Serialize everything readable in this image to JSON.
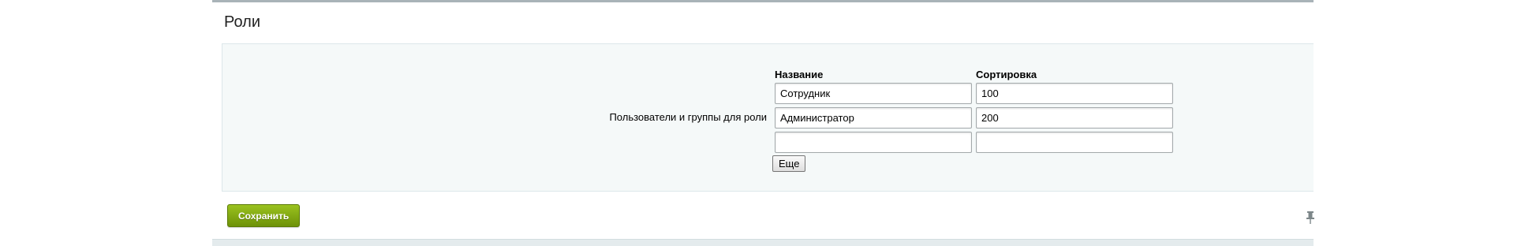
{
  "section": {
    "title": "Роли"
  },
  "field": {
    "label": "Пользователи и группы для роли"
  },
  "table": {
    "columns": {
      "name": "Название",
      "sort": "Сортировка"
    },
    "rows": [
      {
        "name": "Сотрудник",
        "sort": "100"
      },
      {
        "name": "Администратор",
        "sort": "200"
      },
      {
        "name": "",
        "sort": ""
      }
    ]
  },
  "buttons": {
    "more_label": "Еще",
    "save_label": "Сохранить"
  },
  "icons": {
    "pin": "pin-icon"
  },
  "colors": {
    "save_button": "#7ba30f",
    "content_background": "#f5f9f9",
    "panel_top_border": "#a9b3b8"
  }
}
